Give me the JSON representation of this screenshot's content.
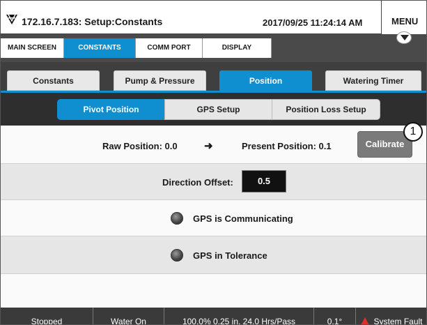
{
  "header": {
    "title": "172.16.7.183: Setup:Constants",
    "datetime": "2017/09/25 11:24:14 AM",
    "menu_label": "MENU"
  },
  "topnav": {
    "tabs": [
      {
        "label": "MAIN SCREEN",
        "active": false
      },
      {
        "label": "CONSTANTS",
        "active": true
      },
      {
        "label": "COMM PORT",
        "active": false
      },
      {
        "label": "DISPLAY",
        "active": false
      }
    ]
  },
  "subtabs": [
    {
      "label": "Constants",
      "active": false
    },
    {
      "label": "Pump & Pressure",
      "active": false
    },
    {
      "label": "Position",
      "active": true
    },
    {
      "label": "Watering Timer",
      "active": false
    }
  ],
  "segments": [
    {
      "label": "Pivot Position",
      "active": true
    },
    {
      "label": "GPS Setup",
      "active": false
    },
    {
      "label": "Position Loss Setup",
      "active": false
    }
  ],
  "position": {
    "raw_label": "Raw Position: 0.0",
    "arrow": "➜",
    "present_label": "Present Position: 0.1",
    "calibrate_label": "Calibrate",
    "callout_number": "1"
  },
  "direction_offset": {
    "label": "Direction Offset:",
    "value": "0.5"
  },
  "indicators": {
    "gps_communicating": "GPS is Communicating",
    "gps_tolerance": "GPS in Tolerance"
  },
  "statusbar": {
    "state": "Stopped",
    "water": "Water On",
    "rate": "100.0%  0.25 in.  24.0 Hrs/Pass",
    "angle": "0.1°",
    "fault": "System Fault"
  },
  "colors": {
    "accent": "#0f8fd0",
    "dark_bar": "#3f3f3f",
    "fault_red": "#e0302a"
  }
}
